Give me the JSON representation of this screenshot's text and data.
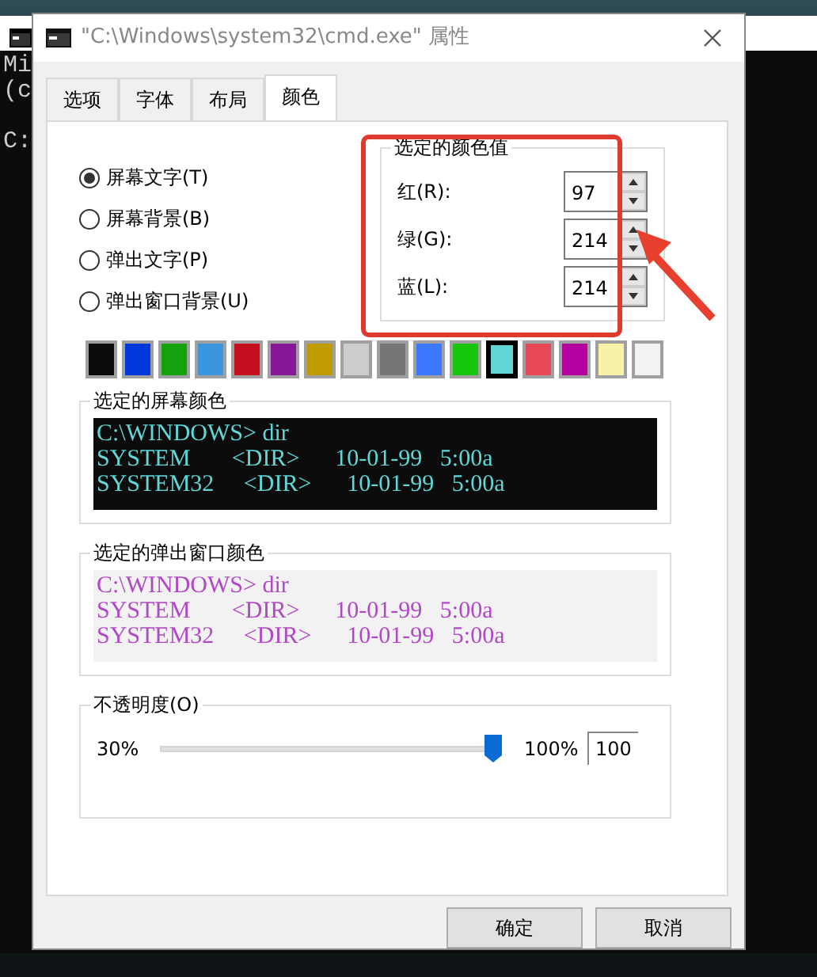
{
  "background_console": {
    "lines": [
      "Mi",
      "(c",
      "C:"
    ]
  },
  "window": {
    "title": "\"C:\\Windows\\system32\\cmd.exe\" 属性"
  },
  "tabs": [
    {
      "label": "选项",
      "selected": false
    },
    {
      "label": "字体",
      "selected": false
    },
    {
      "label": "布局",
      "selected": false
    },
    {
      "label": "颜色",
      "selected": true
    }
  ],
  "targets": [
    {
      "label": "屏幕文字(T)",
      "selected": true
    },
    {
      "label": "屏幕背景(B)",
      "selected": false
    },
    {
      "label": "弹出文字(P)",
      "selected": false
    },
    {
      "label": "弹出窗口背景(U)",
      "selected": false
    }
  ],
  "color_values": {
    "title": "选定的颜色值",
    "fields": [
      {
        "label": "红(R):",
        "value": "97"
      },
      {
        "label": "绿(G):",
        "value": "214"
      },
      {
        "label": "蓝(L):",
        "value": "214"
      }
    ]
  },
  "swatches": [
    {
      "color": "#0c0c0c",
      "selected": false
    },
    {
      "color": "#0037da",
      "selected": false
    },
    {
      "color": "#13a10e",
      "selected": false
    },
    {
      "color": "#3a96dd",
      "selected": false
    },
    {
      "color": "#c50f1f",
      "selected": false
    },
    {
      "color": "#881798",
      "selected": false
    },
    {
      "color": "#c19c00",
      "selected": false
    },
    {
      "color": "#cccccc",
      "selected": false
    },
    {
      "color": "#767676",
      "selected": false
    },
    {
      "color": "#3b78ff",
      "selected": false
    },
    {
      "color": "#16c60c",
      "selected": false
    },
    {
      "color": "#61d6d6",
      "selected": true
    },
    {
      "color": "#e74856",
      "selected": false
    },
    {
      "color": "#b4009e",
      "selected": false
    },
    {
      "color": "#f9f1a5",
      "selected": false
    },
    {
      "color": "#f2f2f2",
      "selected": false
    }
  ],
  "previews": [
    {
      "title": "选定的屏幕颜色",
      "kind": "screen",
      "color": "#61d6d6",
      "lines": [
        "C:\\WINDOWS> dir",
        "SYSTEM       <DIR>      10-01-99   5:00a",
        "SYSTEM32     <DIR>      10-01-99   5:00a"
      ]
    },
    {
      "title": "选定的弹出窗口颜色",
      "kind": "popup",
      "color": "#b148c6",
      "lines": [
        "C:\\WINDOWS> dir",
        "SYSTEM       <DIR>      10-01-99   5:00a",
        "SYSTEM32     <DIR>      10-01-99   5:00a"
      ]
    }
  ],
  "opacity": {
    "title": "不透明度(O)",
    "min_label": "30%",
    "max_label": "100%",
    "level": 1,
    "value": "100"
  },
  "buttons": [
    {
      "label": "确定"
    },
    {
      "label": "取消"
    }
  ]
}
